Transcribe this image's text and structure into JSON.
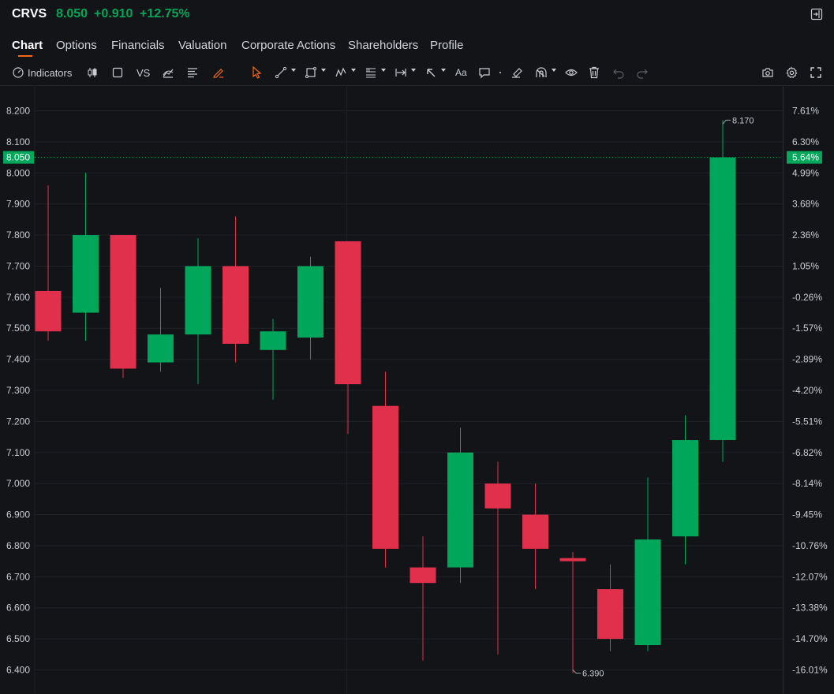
{
  "header": {
    "ticker": "CRVS",
    "price": "8.050",
    "change": "+0.910",
    "change_percent": "+12.75%",
    "up_color": "#00a65a",
    "down_color": "#e0304b"
  },
  "tabs": [
    {
      "label": "Chart",
      "active": true
    },
    {
      "label": "Options"
    },
    {
      "label": "Financials"
    },
    {
      "label": "Valuation"
    },
    {
      "label": "Corporate Actions"
    },
    {
      "label": "Shareholders"
    },
    {
      "label": "Profile"
    }
  ],
  "toolbar": {
    "indicators_label": "Indicators",
    "vs_label": "VS",
    "text_tool_label": "Aa"
  },
  "chart_data": {
    "type": "candlestick",
    "ylim": [
      6.35,
      8.25
    ],
    "y_ticks": [
      "8.200",
      "8.100",
      "8.000",
      "7.900",
      "7.800",
      "7.700",
      "7.600",
      "7.500",
      "7.400",
      "7.300",
      "7.200",
      "7.100",
      "7.000",
      "6.900",
      "6.800",
      "6.700",
      "6.600",
      "6.500",
      "6.400"
    ],
    "right_ticks": [
      "7.61%",
      "6.30%",
      "4.99%",
      "3.68%",
      "2.36%",
      "1.05%",
      "-0.26%",
      "-1.57%",
      "-2.89%",
      "-4.20%",
      "-5.51%",
      "-6.82%",
      "-8.14%",
      "-9.45%",
      "-10.76%",
      "-12.07%",
      "-13.38%",
      "-14.70%",
      "-16.01%"
    ],
    "current_price_label": "8.050",
    "current_percent_label": "5.64%",
    "high_label": "8.170",
    "low_label": "6.390",
    "candles": [
      {
        "open": 7.62,
        "high": 7.96,
        "low": 7.46,
        "close": 7.49
      },
      {
        "open": 7.55,
        "high": 8.0,
        "low": 7.46,
        "close": 7.8
      },
      {
        "open": 7.8,
        "high": 7.8,
        "low": 7.34,
        "close": 7.37
      },
      {
        "open": 7.39,
        "high": 7.63,
        "low": 7.36,
        "close": 7.48
      },
      {
        "open": 7.48,
        "high": 7.79,
        "low": 7.32,
        "close": 7.7
      },
      {
        "open": 7.7,
        "high": 7.86,
        "low": 7.39,
        "close": 7.45
      },
      {
        "open": 7.43,
        "high": 7.53,
        "low": 7.27,
        "close": 7.49
      },
      {
        "open": 7.47,
        "high": 7.73,
        "low": 7.4,
        "close": 7.7
      },
      {
        "open": 7.78,
        "high": 7.78,
        "low": 7.16,
        "close": 7.32
      },
      {
        "open": 7.25,
        "high": 7.36,
        "low": 6.73,
        "close": 6.79
      },
      {
        "open": 6.73,
        "high": 6.83,
        "low": 6.43,
        "close": 6.68
      },
      {
        "open": 6.73,
        "high": 7.18,
        "low": 6.68,
        "close": 7.1
      },
      {
        "open": 7.0,
        "high": 7.07,
        "low": 6.45,
        "close": 6.92
      },
      {
        "open": 6.9,
        "high": 7.0,
        "low": 6.66,
        "close": 6.79
      },
      {
        "open": 6.76,
        "high": 6.78,
        "low": 6.39,
        "close": 6.75
      },
      {
        "open": 6.66,
        "high": 6.74,
        "low": 6.46,
        "close": 6.5
      },
      {
        "open": 6.48,
        "high": 7.02,
        "low": 6.46,
        "close": 6.82
      },
      {
        "open": 6.83,
        "high": 7.22,
        "low": 6.74,
        "close": 7.14
      },
      {
        "open": 7.14,
        "high": 8.17,
        "low": 7.07,
        "close": 8.05
      }
    ]
  }
}
